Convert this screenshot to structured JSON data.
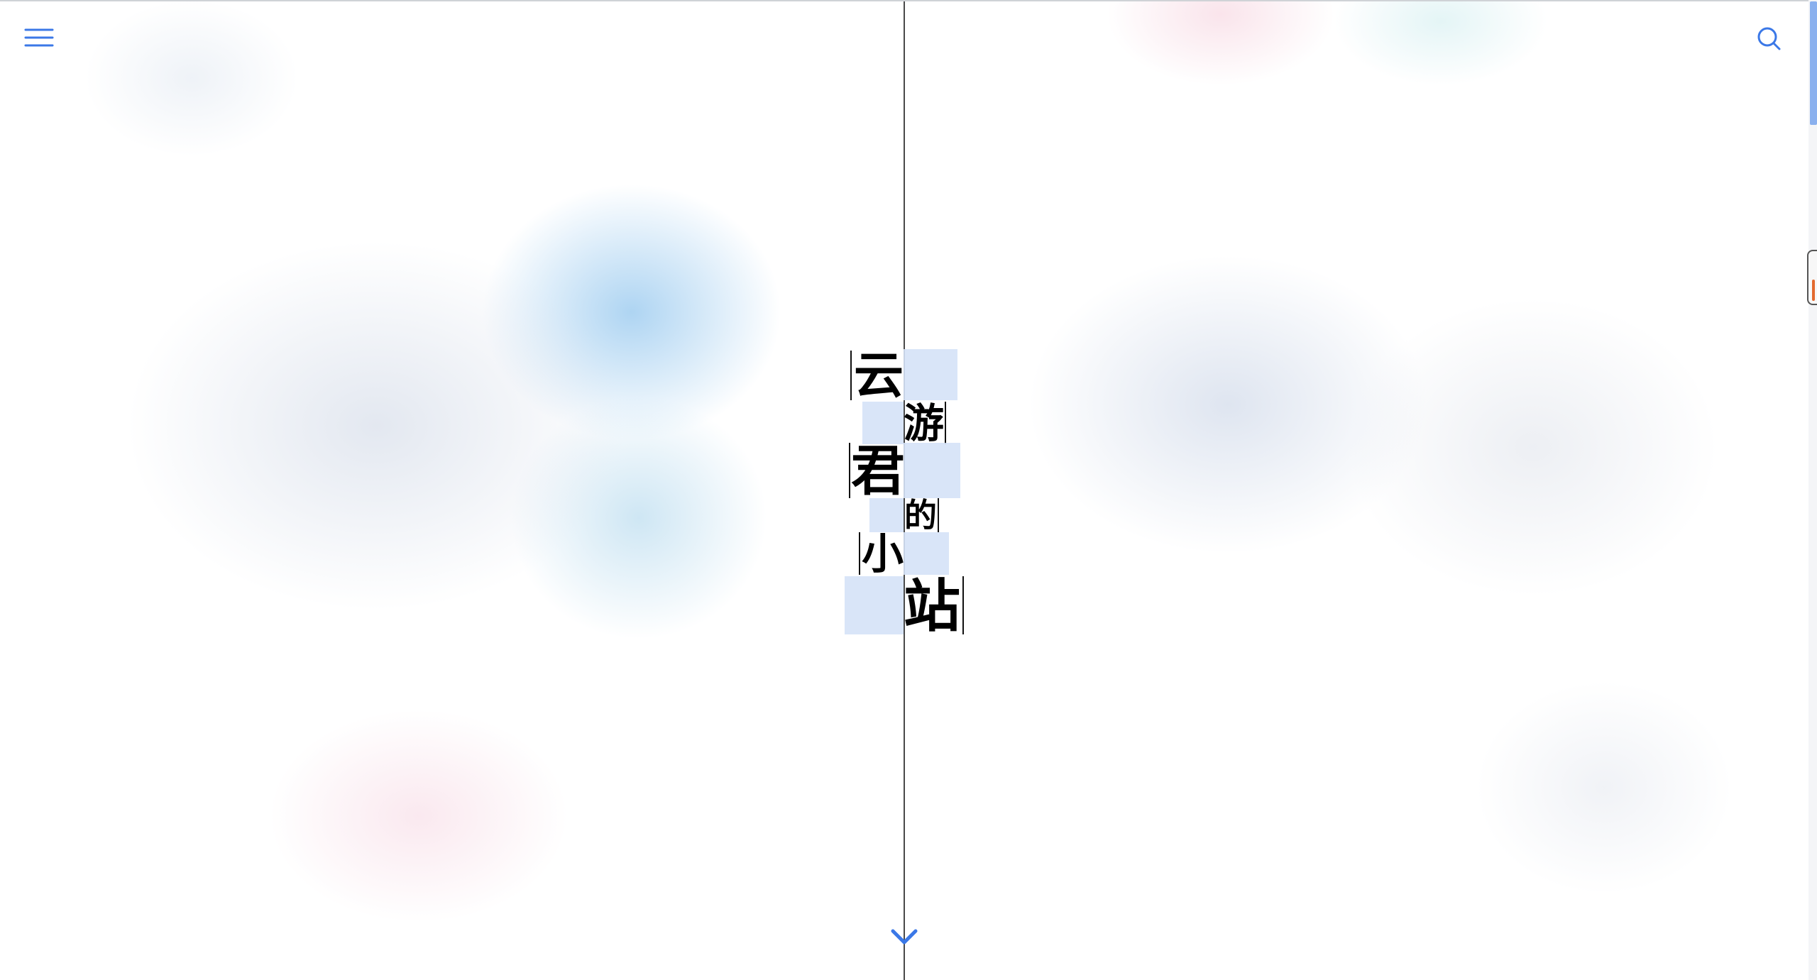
{
  "header": {
    "menu_icon": "hamburger-menu-icon",
    "search_icon": "search-icon"
  },
  "hero": {
    "title_chars": [
      "云",
      "游",
      "君",
      "的",
      "小",
      "站"
    ],
    "scroll_icon": "chevron-down-icon"
  },
  "colors": {
    "accent": "#3b78e7",
    "title_text": "#000000",
    "glyph_highlight": "#d5e2f7",
    "center_line": "#4a4a4a",
    "scrollbar_thumb": "#8ab0ee",
    "handle_accent": "#e36a2f"
  }
}
